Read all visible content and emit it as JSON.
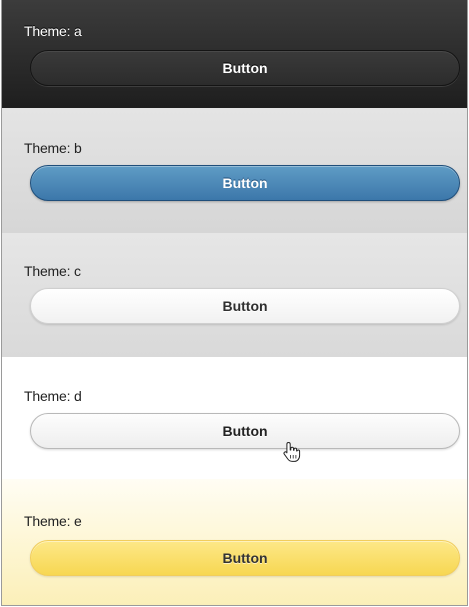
{
  "themes": [
    {
      "id": "a",
      "label": "Theme: a",
      "button_label": "Button",
      "colors": {
        "background": "#2a2a2a",
        "button": "#333333",
        "text": "#ffffff"
      }
    },
    {
      "id": "b",
      "label": "Theme: b",
      "button_label": "Button",
      "colors": {
        "background": "#dcdcdc",
        "button": "#4a88bb",
        "text": "#ffffff"
      }
    },
    {
      "id": "c",
      "label": "Theme: c",
      "button_label": "Button",
      "colors": {
        "background": "#e0e0e0",
        "button": "#f7f7f7",
        "text": "#2f2f2f"
      }
    },
    {
      "id": "d",
      "label": "Theme: d",
      "button_label": "Button",
      "colors": {
        "background": "#ffffff",
        "button": "#f5f5f5",
        "text": "#222222"
      }
    },
    {
      "id": "e",
      "label": "Theme: e",
      "button_label": "Button",
      "colors": {
        "background": "#fdf5cf",
        "button": "#fbe06a",
        "text": "#333333"
      }
    }
  ],
  "cursor": {
    "icon": "hand-pointer-icon"
  }
}
